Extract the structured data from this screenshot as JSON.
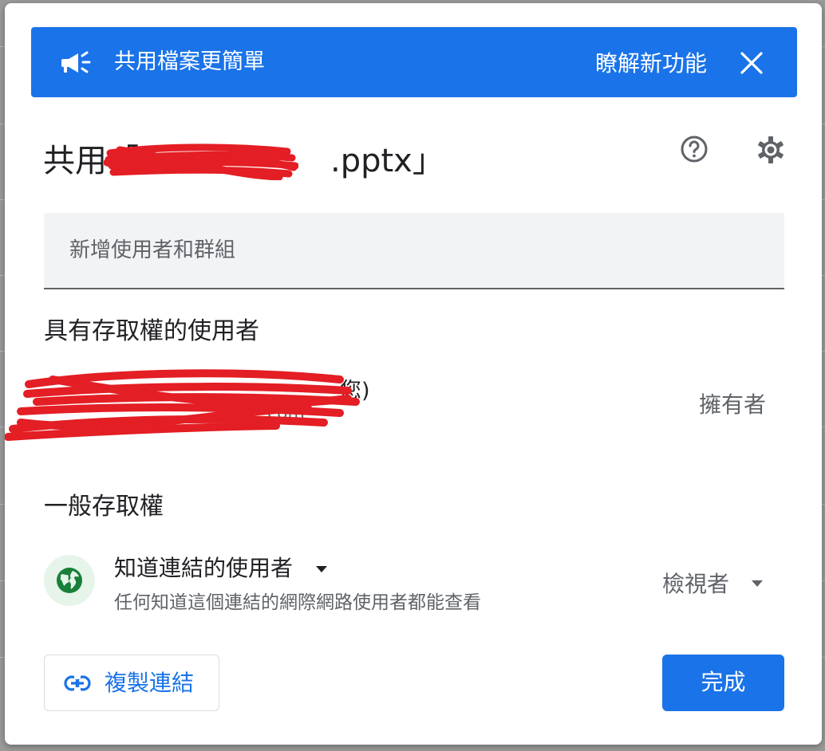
{
  "banner": {
    "title": "共用檔案更簡單",
    "learn_more": "瞭解新功能"
  },
  "dialog": {
    "title_prefix": "共用「",
    "title_suffix": ".pptx」"
  },
  "add_people": {
    "placeholder": "新增使用者和群組"
  },
  "people_section": {
    "heading": "具有存取權的使用者",
    "owner": {
      "name_visible": "您)",
      "email_visible": ".com",
      "role": "擁有者"
    }
  },
  "general_access": {
    "heading": "一般存取權",
    "scope": "知道連結的使用者",
    "description": "任何知道這個連結的網際網路使用者都能查看",
    "role": "檢視者"
  },
  "footer": {
    "copy_link": "複製連結",
    "done": "完成"
  },
  "colors": {
    "accent": "#1a73e8",
    "redaction": "#e31e24",
    "globe": "#188038"
  }
}
